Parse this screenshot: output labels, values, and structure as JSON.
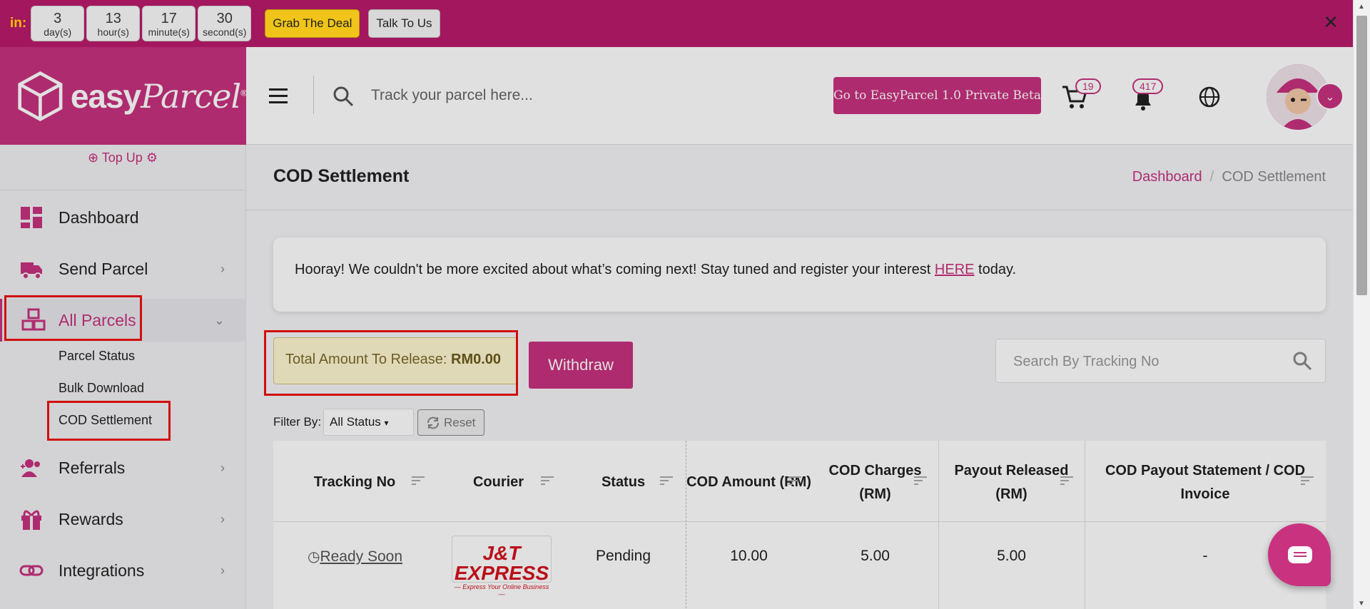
{
  "promo": {
    "prefix": "in:",
    "countdown": [
      {
        "num": "3",
        "unit": "day(s)"
      },
      {
        "num": "13",
        "unit": "hour(s)"
      },
      {
        "num": "17",
        "unit": "minute(s)"
      },
      {
        "num": "30",
        "unit": "second(s)"
      }
    ],
    "deal_label": "Grab The Deal",
    "talk_label": "Talk To Us",
    "close_glyph": "✕"
  },
  "brand": {
    "name": "easy",
    "script": "Parcel",
    "reg": "®"
  },
  "sidebar": {
    "topup_label": "Top Up",
    "items": [
      {
        "label": "Dashboard",
        "icon": "dashboard-icon"
      },
      {
        "label": "Send Parcel",
        "icon": "truck-icon"
      },
      {
        "label": "All Parcels",
        "icon": "boxes-icon"
      },
      {
        "label": "Referrals",
        "icon": "users-plus-icon"
      },
      {
        "label": "Rewards",
        "icon": "gift-icon"
      },
      {
        "label": "Integrations",
        "icon": "link-icon"
      }
    ],
    "sub_items": [
      "Parcel Status",
      "Bulk Download",
      "COD Settlement"
    ]
  },
  "header": {
    "search_placeholder": "Track your parcel here...",
    "beta_label": "Go to EasyParcel 1.0 Private Beta",
    "cart_count": "19",
    "notif_count": "417"
  },
  "page": {
    "title": "COD Settlement",
    "breadcrumb": [
      "Dashboard",
      "/",
      "COD Settlement"
    ],
    "notice": {
      "text_before": "Hooray! We couldn't be more excited about what’s coming next! Stay tuned and register your interest ",
      "link": "HERE",
      "text_after": " today."
    },
    "amount_label": "Total Amount To Release: ",
    "amount_value": "RM0.00",
    "withdraw_label": "Withdraw",
    "tracking_placeholder": "Search By Tracking No",
    "filter_label": "Filter By:",
    "filter_value": "All Status",
    "reset_label": "Reset"
  },
  "table": {
    "columns": [
      "Tracking No",
      "Courier",
      "Status",
      "COD Amount (RM)",
      "COD Charges (RM)",
      "Payout Released (RM)",
      "COD Payout Statement / COD Invoice"
    ],
    "rows": [
      {
        "tracking": "Ready Soon",
        "courier": "J&T EXPRESS",
        "courier_tag": "— Express Your Online Business —",
        "status": "Pending",
        "cod_amount": "10.00",
        "cod_charges": "5.00",
        "payout": "5.00",
        "statement": "-"
      }
    ]
  },
  "colors": {
    "brand": "#c8327f",
    "promo_bar": "#a3175e",
    "deal": "#f0c419"
  }
}
